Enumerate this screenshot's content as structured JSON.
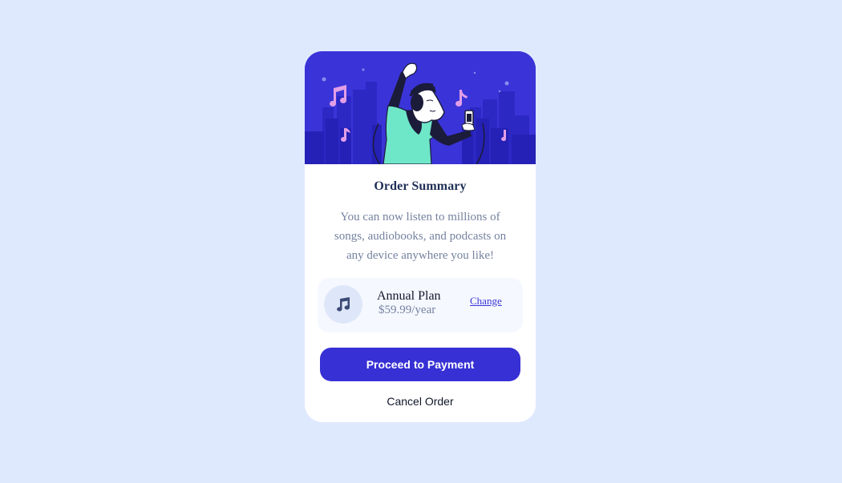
{
  "colors": {
    "page_background": "#dfe9fe",
    "card_background": "#ffffff",
    "hero_background": "#3a34d8",
    "primary_button": "#3730d4",
    "title_text": "#1f2f56",
    "muted_text": "#7582a0",
    "plan_background": "#f5f8ff"
  },
  "hero": {
    "illustration": "person-listening-to-music-illustration"
  },
  "card": {
    "title": "Order Summary",
    "description": "You can now listen to millions of songs, audiobooks, and podcasts on any device anywhere you like!"
  },
  "plan": {
    "icon": "music-note-icon",
    "name": "Annual Plan",
    "price": "$59.99/year",
    "change_label": "Change"
  },
  "actions": {
    "proceed_label": "Proceed to Payment",
    "cancel_label": "Cancel Order"
  }
}
